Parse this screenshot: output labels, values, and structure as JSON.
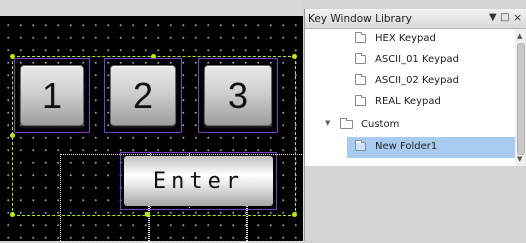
{
  "canvas": {
    "keys": [
      {
        "label": "1"
      },
      {
        "label": "2"
      },
      {
        "label": "3"
      }
    ],
    "enter_label": "Enter"
  },
  "panel": {
    "title": "Key Window Library",
    "controls": {
      "dropdown": "▼",
      "restore": "□",
      "close": "×"
    },
    "tree": [
      {
        "label": "HEX Keypad",
        "selected": false
      },
      {
        "label": "ASCII_01 Keypad",
        "selected": false
      },
      {
        "label": "ASCII_02 Keypad",
        "selected": false
      },
      {
        "label": "REAL Keypad",
        "selected": false
      },
      {
        "label": "Custom",
        "expanded": true
      },
      {
        "label": "New Folder1",
        "selected": true
      }
    ],
    "scroll": {
      "up": "▲",
      "down": "▼"
    }
  },
  "colors": {
    "selection": "#b6f000",
    "key_border": "#7d3cc8",
    "tree_highlight": "#a8cbf0"
  }
}
